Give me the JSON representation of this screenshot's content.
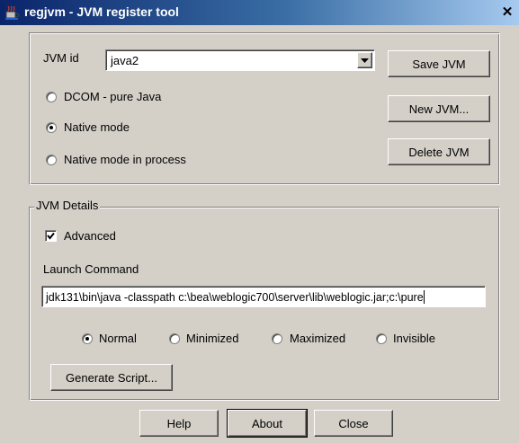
{
  "window": {
    "title": "regjvm - JVM register tool",
    "close_glyph": "✕",
    "icon": "java-cup-icon"
  },
  "jvm": {
    "id_label": "JVM id",
    "id_value": "java2",
    "modes": [
      {
        "label": "DCOM - pure Java",
        "checked": false
      },
      {
        "label": "Native mode",
        "checked": true
      },
      {
        "label": "Native mode in process",
        "checked": false
      }
    ],
    "buttons": {
      "save": "Save JVM",
      "new": "New JVM...",
      "delete": "Delete JVM"
    }
  },
  "details": {
    "legend": "JVM Details",
    "advanced_label": "Advanced",
    "advanced_checked": true,
    "launch_label": "Launch Command",
    "launch_value": "jdk131\\bin\\java -classpath c:\\bea\\weblogic700\\server\\lib\\weblogic.jar;c:\\pure",
    "window_states": [
      {
        "label": "Normal",
        "checked": true
      },
      {
        "label": "Minimized",
        "checked": false
      },
      {
        "label": "Maximized",
        "checked": false
      },
      {
        "label": "Invisible",
        "checked": false
      }
    ],
    "generate_button": "Generate Script..."
  },
  "footer": {
    "help": "Help",
    "about": "About",
    "close": "Close"
  }
}
